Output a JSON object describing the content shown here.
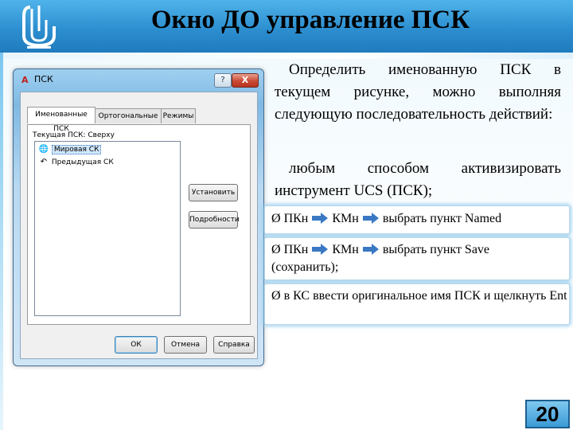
{
  "slide": {
    "title": "Окно ДО управление ПСК",
    "page_number": "20",
    "colors": {
      "header": "#2d8fd0",
      "accent": "#3b9bd6"
    }
  },
  "dialog": {
    "app_icon": "A",
    "title": "ПСК",
    "help_label": "?",
    "close_label": "X",
    "tabs": [
      "Именованные ПСК",
      "Ортогональные ПСК",
      "Режимы"
    ],
    "current_ucs": "Текущая ПСК:  Сверху",
    "list_items": [
      {
        "label": "Мировая СК",
        "icon": "world-icon"
      },
      {
        "label": "Предыдущая СК",
        "icon": "previous-arrow-icon"
      }
    ],
    "side_buttons": [
      "Установить",
      "Подробности"
    ],
    "bottom_buttons": [
      "ОК",
      "Отмена",
      "Справка"
    ]
  },
  "text": {
    "intro": "Определить именованную ПСК в текущем рисунке, можно выполняя следующую последовательность действий:",
    "method": "любым способом активизировать инструмент UCS (ПСК);"
  },
  "steps": [
    {
      "part1": "ПКн",
      "part2": "КМн",
      "part3": "выбрать пункт Named"
    },
    {
      "part1": "ПКн",
      "part2": "КМн",
      "part3": "выбрать пункт Save",
      "part4": "(сохранить);"
    },
    {
      "text": "в КС ввести оригинальное имя ПСК и щелкнуть Ent"
    }
  ],
  "bullet_symbol": "Ø"
}
